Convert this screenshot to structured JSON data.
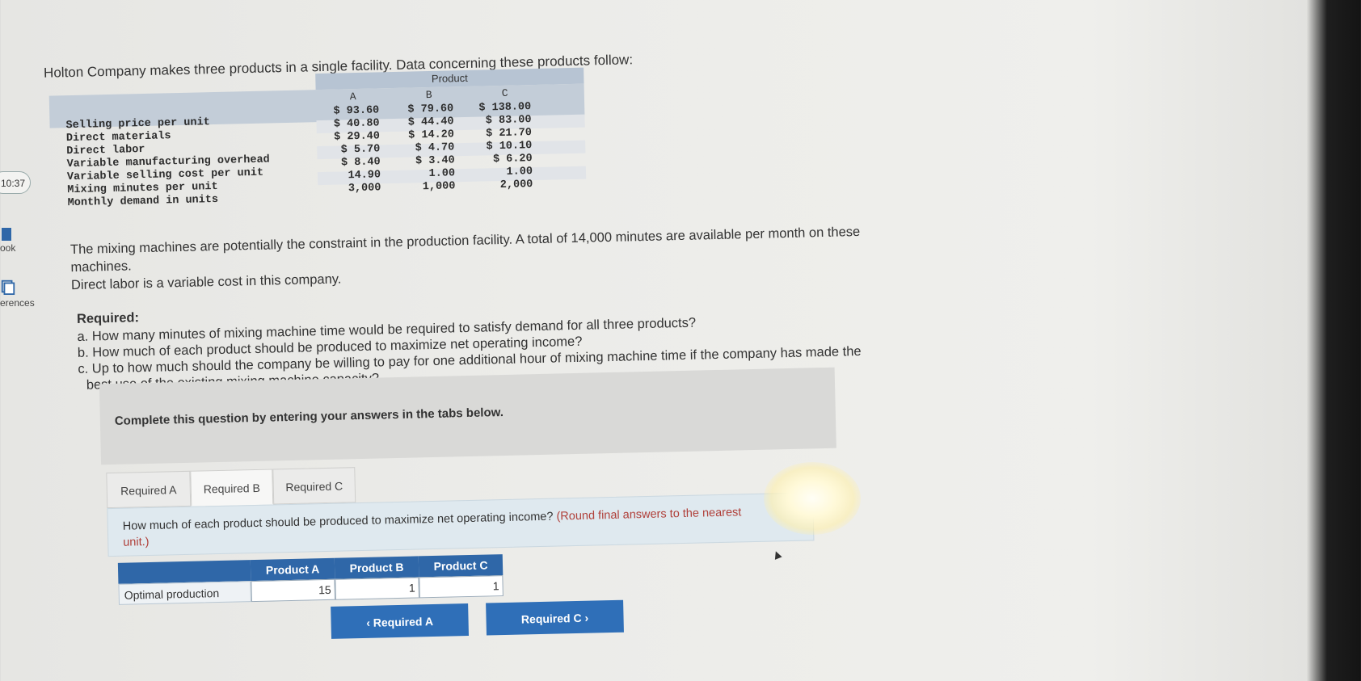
{
  "sidebar": {
    "clock": "10:37",
    "book_label": "ook",
    "references_label": "erences"
  },
  "intro": "Holton Company makes three products in a single facility. Data concerning these products follow:",
  "product_table": {
    "group_header": "Product",
    "columns": [
      "A",
      "B",
      "C"
    ],
    "rows": [
      {
        "label": "Selling price per unit",
        "values": [
          "$ 93.60",
          "$ 79.60",
          "$ 138.00"
        ]
      },
      {
        "label": "Direct materials",
        "values": [
          "$ 40.80",
          "$ 44.40",
          "$ 83.00"
        ]
      },
      {
        "label": "Direct labor",
        "values": [
          "$ 29.40",
          "$ 14.20",
          "$ 21.70"
        ]
      },
      {
        "label": "Variable manufacturing overhead",
        "values": [
          "$ 5.70",
          "$ 4.70",
          "$ 10.10"
        ]
      },
      {
        "label": "Variable selling cost per unit",
        "values": [
          "$ 8.40",
          "$ 3.40",
          "$ 6.20"
        ]
      },
      {
        "label": "Mixing minutes per unit",
        "values": [
          "14.90",
          "1.00",
          "1.00"
        ]
      },
      {
        "label": "Monthly demand in units",
        "values": [
          "3,000",
          "1,000",
          "2,000"
        ]
      }
    ]
  },
  "constraint_text": "The mixing machines are potentially the constraint in the production facility. A total of 14,000 minutes are available per month on these",
  "constraint_text_2": "machines.",
  "labor_text": "Direct labor is a variable cost in this company.",
  "required": {
    "title": "Required:",
    "a": "a. How many minutes of mixing machine time would be required to satisfy demand for all three products?",
    "b": "b. How much of each product should be produced to maximize net operating income?",
    "c1": "c. Up to how much should the company be willing to pay for one additional hour of mixing machine time if the company has made the",
    "c2": "best use of the existing mixing machine capacity?"
  },
  "panel_text": "Complete this question by entering your answers in the tabs below.",
  "tabs": [
    {
      "label": "Required A",
      "active": false
    },
    {
      "label": "Required B",
      "active": true
    },
    {
      "label": "Required C",
      "active": false
    }
  ],
  "question": {
    "text": "How much of each product should be produced to maximize net operating income?",
    "hint": "(Round final answers to the nearest",
    "hint_cont": "unit.)"
  },
  "answer_table": {
    "headers": [
      "Product A",
      "Product B",
      "Product C"
    ],
    "row_label": "Optimal production",
    "values": [
      "15",
      "1",
      "1"
    ]
  },
  "nav": {
    "prev_label": "‹  Required A",
    "next_label": "Required C  ›"
  }
}
